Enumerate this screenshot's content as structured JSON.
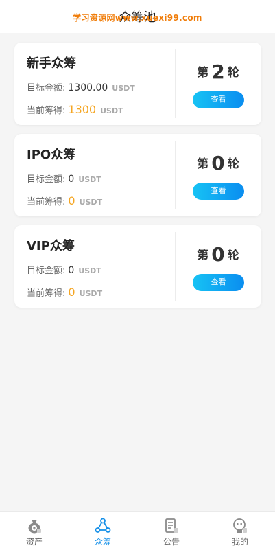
{
  "header": {
    "title": "众筹池",
    "watermark": "学习资源网www.xuexi99.com"
  },
  "cards": [
    {
      "name": "新手众筹",
      "target_label": "目标金额:",
      "target_amount": "1300.00",
      "target_unit": "USDT",
      "raised_label": "当前筹得:",
      "raised_amount": "1300",
      "raised_unit": "USDT",
      "round_prefix": "第",
      "round_number": "2",
      "round_suffix": "轮",
      "button_label": "查看"
    },
    {
      "name": "IPO众筹",
      "target_label": "目标金额:",
      "target_amount": "0",
      "target_unit": "USDT",
      "raised_label": "当前筹得:",
      "raised_amount": "0",
      "raised_unit": "USDT",
      "round_prefix": "第",
      "round_number": "0",
      "round_suffix": "轮",
      "button_label": "查看"
    },
    {
      "name": "VIP众筹",
      "target_label": "目标金额:",
      "target_amount": "0",
      "target_unit": "USDT",
      "raised_label": "当前筹得:",
      "raised_amount": "0",
      "raised_unit": "USDT",
      "round_prefix": "第",
      "round_number": "0",
      "round_suffix": "轮",
      "button_label": "查看"
    }
  ],
  "tabbar": {
    "items": [
      {
        "label": "资产",
        "icon": "money-bag-icon",
        "active": false
      },
      {
        "label": "众筹",
        "icon": "share-nodes-icon",
        "active": true
      },
      {
        "label": "公告",
        "icon": "document-icon",
        "active": false
      },
      {
        "label": "我的",
        "icon": "profile-icon",
        "active": false
      }
    ]
  },
  "colors": {
    "accent": "#1690e8",
    "button_gradient_start": "#17c3f4",
    "button_gradient_end": "#0a8df0",
    "amount_orange": "#f5a623",
    "watermark": "#f07d0a",
    "background": "#f5f5f5"
  }
}
